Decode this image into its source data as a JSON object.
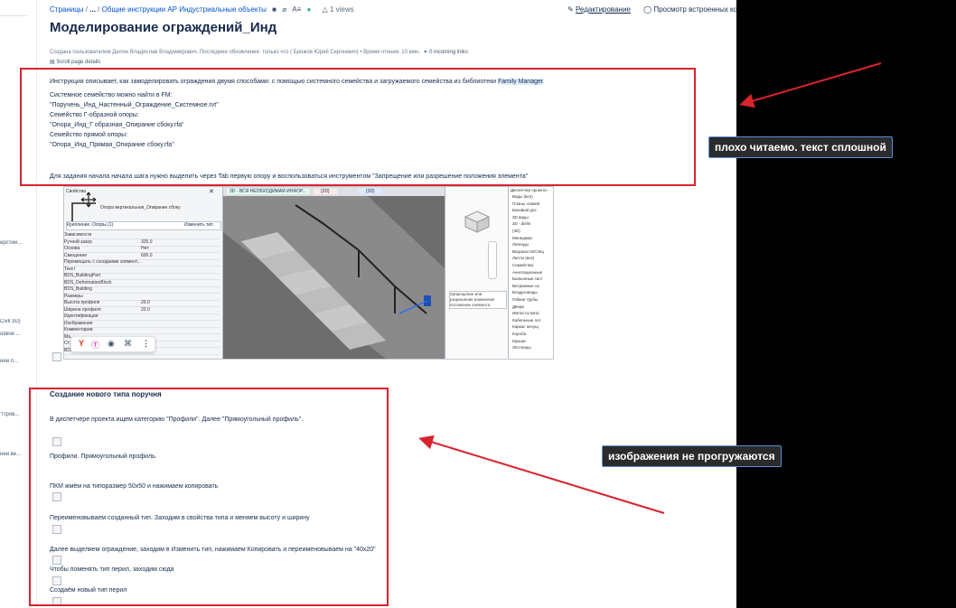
{
  "breadcrumb": {
    "pages": "Страницы",
    "sep1": "/",
    "ellipsis": "...",
    "sep2": "/",
    "parent": "Общие инструкции АР Индустриальные объекты",
    "restrictions": "A≡",
    "views": "1 views"
  },
  "actions": {
    "edit": "Редактирование",
    "preview": "Просмотр встроенных ко"
  },
  "title": "Моделирование ограждений_Инд",
  "meta": {
    "text": "Создана пользователем Дютин Владислав Владимирович. Последнее обновление: только что ( Брежов Юрий Сергеевич) • Время чтения: 10 мин.",
    "links": "0 incoming links"
  },
  "scroll_details": "Scroll page details",
  "intro": {
    "line1_a": "Инструкция описывает, как замоделировать ограждения двумя способами: с помощью системного семейства и загружаемого семейства из библиотеки ",
    "line1_b": "Family Manager",
    "line1_c": ".",
    "line2": "Системное семейство можно найти в FM:",
    "line3": "\"Поручень_Инд_Настенный_Ограждение_Системное.rvt\"",
    "line4": "Семейство Г-образной опоры:",
    "line5": "\"Опора_Инд_Г образная_Опирание сбоку.rfa\"",
    "line6": "Семейство прямой опоры:",
    "line7": "\"Опора_Инд_Прямая_Опирание сбоку.rfa\"",
    "line8": "Для задания начала начала шага нужно выделить через Tab первую опору и воспользоваться инструментом \"Запрещение или разрешение положения элемента\""
  },
  "revit": {
    "props_title": "Свойства",
    "family": "Опора вертикальная_Опирание сбоку",
    "type_filter": "Крепление: Опоры (1)",
    "edit_type": "Изменить тип",
    "rows": [
      {
        "k": "Зависимости",
        "v": ""
      },
      {
        "k": "Ручной зазор",
        "v": "325.0"
      },
      {
        "k": "Основа",
        "v": "Нет"
      },
      {
        "k": "Смещение",
        "v": "600.0"
      },
      {
        "k": "Перемещать с соседними элемент...",
        "v": ""
      },
      {
        "k": "Текст",
        "v": ""
      },
      {
        "k": "BDS_BuildingPart",
        "v": ""
      },
      {
        "k": "BDS_DeformationBlock",
        "v": ""
      },
      {
        "k": "BDS_Building",
        "v": ""
      },
      {
        "k": "Размеры",
        "v": ""
      },
      {
        "k": "Высота профиля",
        "v": "20.0"
      },
      {
        "k": "Ширина профиля",
        "v": "20.0"
      },
      {
        "k": "Идентификация",
        "v": ""
      },
      {
        "k": "Изображение",
        "v": ""
      },
      {
        "k": "Комментарии",
        "v": ""
      },
      {
        "k": "Ма...",
        "v": ""
      },
      {
        "k": "Ст...",
        "v": ""
      },
      {
        "k": "BDS_...",
        "v": ""
      }
    ],
    "tab1": "3D - ВСЯ НЕОБХОДИМАЯ ИНФОР...",
    "tab2": "{3D}",
    "tab3": "{3D}",
    "tooltip": "Запрещение или разрешение изменения положения элемента",
    "browser_title": "Диспетчер проекта -",
    "browser_items": [
      "Виды (все)",
      "Планы этажей",
      "Базовый уро",
      "3D виды",
      "3D - disfin",
      "{3D}",
      "Менеджер",
      "Легенды",
      "Ведомости/Спец",
      "Листы (все)",
      "Семейства",
      "Аннотационные",
      "Балконные сист",
      "Витражные си",
      "Воздуховоды",
      "Гибкие трубы",
      "Двери",
      "Импосты витр",
      "Кабельные лот",
      "Каркас несущ",
      "Короба",
      "Крыши",
      "Лестницы"
    ]
  },
  "section": {
    "title": "Создание нового типа поручня",
    "steps": [
      "В диспетчере проекта ищем категорию \"Профили\". Далее \"Прямоугольный профиль\".",
      "Профили. Прямоугольный профиль.",
      "ПКМ жмём на типоразмер 50х50 и нажимаем копировать",
      "Переименовываем созданный тип. Заходим в свойства типа и меняем высоту и ширину",
      "Далее выделяем ограждение, заходим в Изменить тип, нажимаем Копировать и переименовываем на \"40х20\"",
      "Чтобы поменять тип перил, заходим сюда",
      "Создаём новый тип перил"
    ]
  },
  "sidebar_fragments": [
    "ерстий...",
    "Civil 3D)",
    "odesk ...",
    "ний п...",
    "\"Пров...",
    "ней ве..."
  ],
  "annotations": {
    "note1": "плохо читаемо. текст сплошной",
    "note2": "изображения не прогружаются",
    "color": "#d9232d"
  }
}
